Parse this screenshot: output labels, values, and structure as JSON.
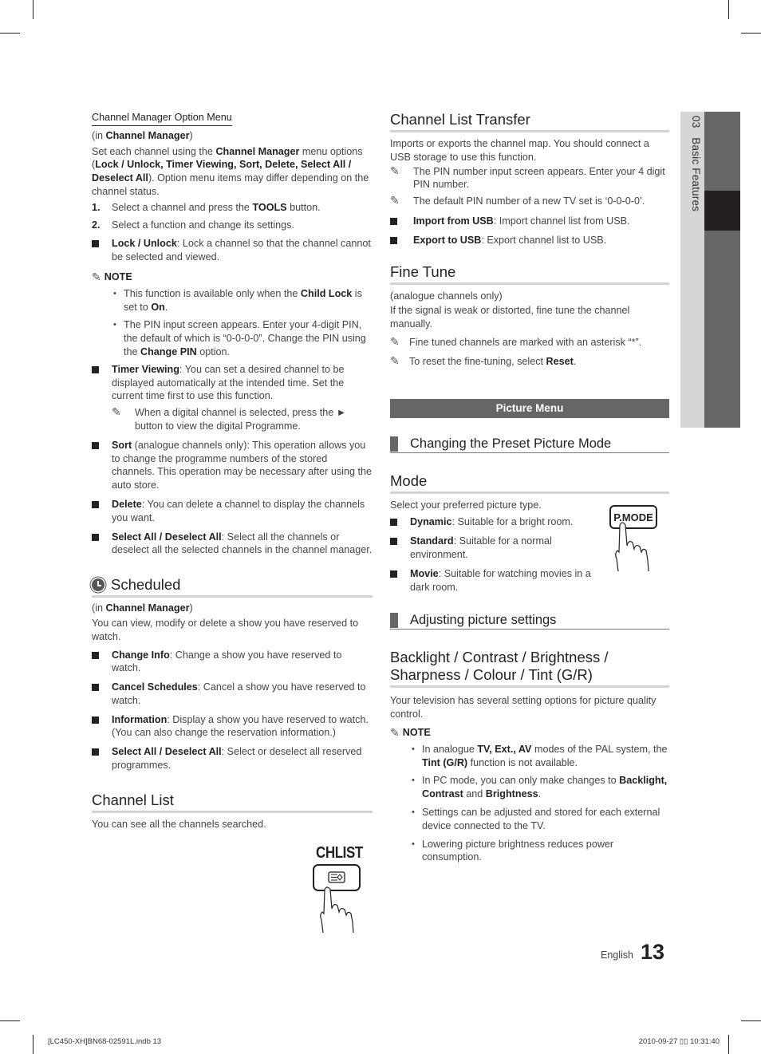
{
  "sidebar": {
    "chapter_number": "03",
    "chapter_title": "Basic Features"
  },
  "left_column": {
    "option_menu": {
      "title": "Channel Manager Option Menu",
      "context_prefix": "(in ",
      "context_bold": "Channel Manager",
      "context_suffix": ")",
      "intro": [
        {
          "t": "Set each channel using the ",
          "b": false
        },
        {
          "t": "Channel Manager",
          "b": true
        },
        {
          "t": " menu options (",
          "b": false
        },
        {
          "t": "Lock / Unlock, Timer Viewing, Sort, Delete, Select All / Deselect All",
          "b": true
        },
        {
          "t": "). Option menu items may differ depending on the channel status.",
          "b": false
        }
      ],
      "steps": [
        {
          "n": "1.",
          "parts": [
            {
              "t": "Select a channel and press the ",
              "b": false
            },
            {
              "t": "TOOLS",
              "b": true
            },
            {
              "t": " button.",
              "b": false
            }
          ]
        },
        {
          "n": "2.",
          "parts": [
            {
              "t": "Select a function and change its settings.",
              "b": false
            }
          ]
        }
      ],
      "lock": {
        "label": "Lock / Unlock",
        "text": ": Lock a channel so that the channel cannot be selected and viewed."
      },
      "note_label": "NOTE",
      "lock_notes": [
        [
          {
            "t": "This function is available only when the ",
            "b": false
          },
          {
            "t": "Child Lock",
            "b": true
          },
          {
            "t": " is set to ",
            "b": false
          },
          {
            "t": "On",
            "b": true
          },
          {
            "t": ".",
            "b": false
          }
        ],
        [
          {
            "t": "The PIN input screen appears. Enter your 4-digit PIN, the default of which is “0-0-0-0”. Change the PIN using the ",
            "b": false
          },
          {
            "t": "Change PIN",
            "b": true
          },
          {
            "t": " option.",
            "b": false
          }
        ]
      ],
      "timer": {
        "label": "Timer Viewing",
        "text": ": You can set a desired channel to be displayed automatically at the intended time. Set the current time first to use this function.",
        "note": "When a digital channel is selected, press the ► button to view the digital Programme."
      },
      "sort": {
        "label": "Sort",
        "text": " (analogue channels only): This operation allows you to change the programme numbers of the stored channels. This operation may be necessary after using the auto store."
      },
      "delete": {
        "label": "Delete",
        "text": ": You can delete a channel to display the channels you want."
      },
      "select_all": {
        "label": "Select All / Deselect All",
        "text": ": Select all the channels or deselect all the selected channels in the channel manager."
      }
    },
    "scheduled": {
      "title": "Scheduled",
      "context_prefix": "(in ",
      "context_bold": "Channel Manager",
      "context_suffix": ")",
      "intro": "You can view, modify or delete a show you have reserved to watch.",
      "items": [
        {
          "label": "Change Info",
          "text": ": Change a show you have reserved to watch."
        },
        {
          "label": "Cancel Schedules",
          "text": ": Cancel a show you have reserved to watch."
        },
        {
          "label": "Information",
          "text": ": Display a show you have reserved to watch. (You can also change the reservation information.)"
        },
        {
          "label": "Select All / Deselect All",
          "text": ": Select or deselect all reserved programmes."
        }
      ]
    },
    "channel_list": {
      "title": "Channel List",
      "text": "You can see all the channels searched.",
      "remote_label": "CHLIST"
    }
  },
  "right_column": {
    "transfer": {
      "title": "Channel List Transfer",
      "intro": "Imports or exports the channel map. You should connect a USB storage to use this function.",
      "notes": [
        "The PIN number input screen appears. Enter your 4 digit PIN number.",
        "The default PIN number of a new TV set is ‘0-0-0-0’."
      ],
      "items": [
        {
          "label": "Import from USB",
          "text": ": Import channel list from USB."
        },
        {
          "label": "Export to USB",
          "text": ": Export channel list to USB."
        }
      ]
    },
    "fine_tune": {
      "title": "Fine Tune",
      "context": "(analogue channels only)",
      "intro": "If the signal is weak or distorted, fine tune the channel manually.",
      "note1": "Fine tuned channels are marked with an asterisk “*”.",
      "note2_prefix": "To reset the fine-tuning, select ",
      "note2_bold": "Reset",
      "note2_suffix": "."
    },
    "picture_menu": {
      "title": "Picture Menu"
    },
    "preset_mode": {
      "title": "Changing the Preset Picture Mode"
    },
    "mode": {
      "title": "Mode",
      "intro": "Select your preferred picture type.",
      "remote_label": "P.MODE",
      "items": [
        {
          "label": "Dynamic",
          "text": ": Suitable for a bright room."
        },
        {
          "label": "Standard",
          "text": ": Suitable for a normal environment."
        },
        {
          "label": "Movie",
          "text": ": Suitable for watching movies in a dark room."
        }
      ]
    },
    "adjusting": {
      "title": "Adjusting picture settings"
    },
    "backlight": {
      "title": "Backlight / Contrast / Brightness / Sharpness / Colour / Tint (G/R)",
      "intro": "Your television has several setting options for picture quality control.",
      "note_label": "NOTE",
      "notes": [
        [
          {
            "t": "In analogue ",
            "b": false
          },
          {
            "t": "TV, Ext., AV",
            "b": true
          },
          {
            "t": " modes of the PAL system, the ",
            "b": false
          },
          {
            "t": "Tint (G/R)",
            "b": true
          },
          {
            "t": " function is not available.",
            "b": false
          }
        ],
        [
          {
            "t": "In PC mode, you can only make changes to ",
            "b": false
          },
          {
            "t": "Backlight, Contrast",
            "b": true
          },
          {
            "t": " and ",
            "b": false
          },
          {
            "t": "Brightness",
            "b": true
          },
          {
            "t": ".",
            "b": false
          }
        ],
        [
          {
            "t": "Settings can be adjusted and stored for each external device connected to the TV.",
            "b": false
          }
        ],
        [
          {
            "t": "Lowering picture brightness reduces power consumption.",
            "b": false
          }
        ]
      ]
    }
  },
  "footer": {
    "language": "English",
    "page_number": "13",
    "slug_left": "[LC450-XH]BN68-02591L.indb   13",
    "slug_right": "2010-09-27   ▯▯ 10:31:40"
  },
  "icons": {
    "pencil": "✎"
  },
  "colors": {
    "section_bar": "#666666",
    "sidebar_light": "#d6d6d6",
    "sidebar_dark": "#666666",
    "sidebar_active": "#231f20"
  }
}
